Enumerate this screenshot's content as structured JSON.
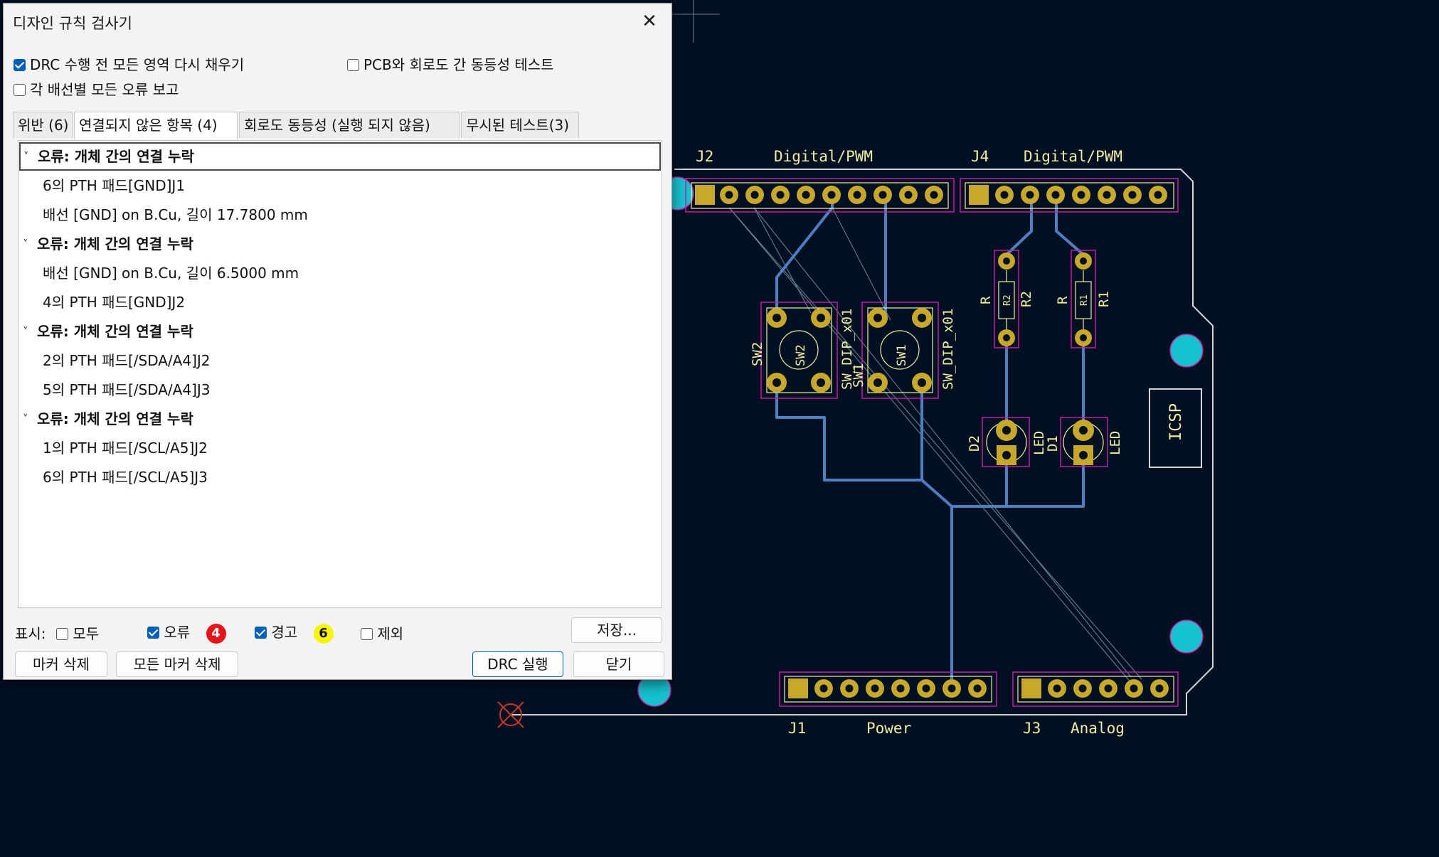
{
  "dialog": {
    "title": "디자인 규칙 검사기",
    "close_icon": "✕",
    "options": {
      "refill_zones": {
        "label": "DRC 수행 전 모든 영역 다시 채우기",
        "checked": true
      },
      "parity_test": {
        "label": "PCB와 회로도 간 동등성 테스트",
        "checked": false
      },
      "report_all": {
        "label": "각 배선별 모든 오류 보고",
        "checked": false
      }
    },
    "tabs": [
      "위반 (6)",
      "연결되지 않은 항목 (4)",
      "회로도 동등성 (실행 되지 않음)",
      "무시된 테스트(3)"
    ],
    "active_tab": 1,
    "chevron_icon": "˅",
    "items": [
      {
        "kind": "error",
        "text": "오류: 개체 간의 연결 누락"
      },
      {
        "kind": "detail",
        "text": "6의 PTH 패드[GND]J1"
      },
      {
        "kind": "detail",
        "text": "배선 [GND] on B.Cu, 길이 17.7800 mm"
      },
      {
        "kind": "error",
        "text": "오류: 개체 간의 연결 누락"
      },
      {
        "kind": "detail",
        "text": "배선 [GND] on B.Cu, 길이 6.5000 mm"
      },
      {
        "kind": "detail",
        "text": "4의 PTH 패드[GND]J2"
      },
      {
        "kind": "error",
        "text": "오류: 개체 간의 연결 누락"
      },
      {
        "kind": "detail",
        "text": "2의 PTH 패드[/SDA/A4]J2"
      },
      {
        "kind": "detail",
        "text": "5의 PTH 패드[/SDA/A4]J3"
      },
      {
        "kind": "error",
        "text": "오류: 개체 간의 연결 누락"
      },
      {
        "kind": "detail",
        "text": "1의 PTH 패드[/SCL/A5]J2"
      },
      {
        "kind": "detail",
        "text": "6의 PTH 패드[/SCL/A5]J3"
      }
    ],
    "filter": {
      "label": "표시:",
      "all": {
        "label": "모두",
        "checked": false
      },
      "errors": {
        "label": "오류",
        "checked": true,
        "count": "4",
        "color": "#e8141b"
      },
      "warnings": {
        "label": "경고",
        "checked": true,
        "count": "6",
        "color": "#f7f40a"
      },
      "excluded": {
        "label": "제외",
        "checked": false
      }
    },
    "buttons": {
      "save": "저장...",
      "delete_markers": "마커 삭제",
      "delete_all_markers": "모든 마커 삭제",
      "run_drc": "DRC 실행",
      "close": "닫기"
    }
  },
  "pcb": {
    "labels": {
      "j2": "J2",
      "j2_desc": "Digital/PWM",
      "j4": "J4",
      "j4_desc": "Digital/PWM",
      "j1": "J1",
      "j1_desc": "Power",
      "j3": "J3",
      "j3_desc": "Analog",
      "sw2": "SW2",
      "sw2_val": "SW_DIP_x01",
      "sw2_in": "SW2",
      "sw1": "SW1",
      "sw1_val": "SW_DIP_x01",
      "sw1_in": "SW1",
      "r2": "R2",
      "r2_val": "R",
      "r2_in": "R2",
      "r1": "R1",
      "r1_val": "R",
      "r1_in": "R1",
      "d2": "D2",
      "d2_val": "LED",
      "d1": "D1",
      "d1_val": "LED",
      "icsp": "ICSP"
    },
    "colors": {
      "board": "#001023",
      "copper": "#c8a82a",
      "trace": "#4d7fc4",
      "courtyard": "#c21ea2",
      "silk": "#f2eda1",
      "via": "#16c2d0"
    }
  }
}
